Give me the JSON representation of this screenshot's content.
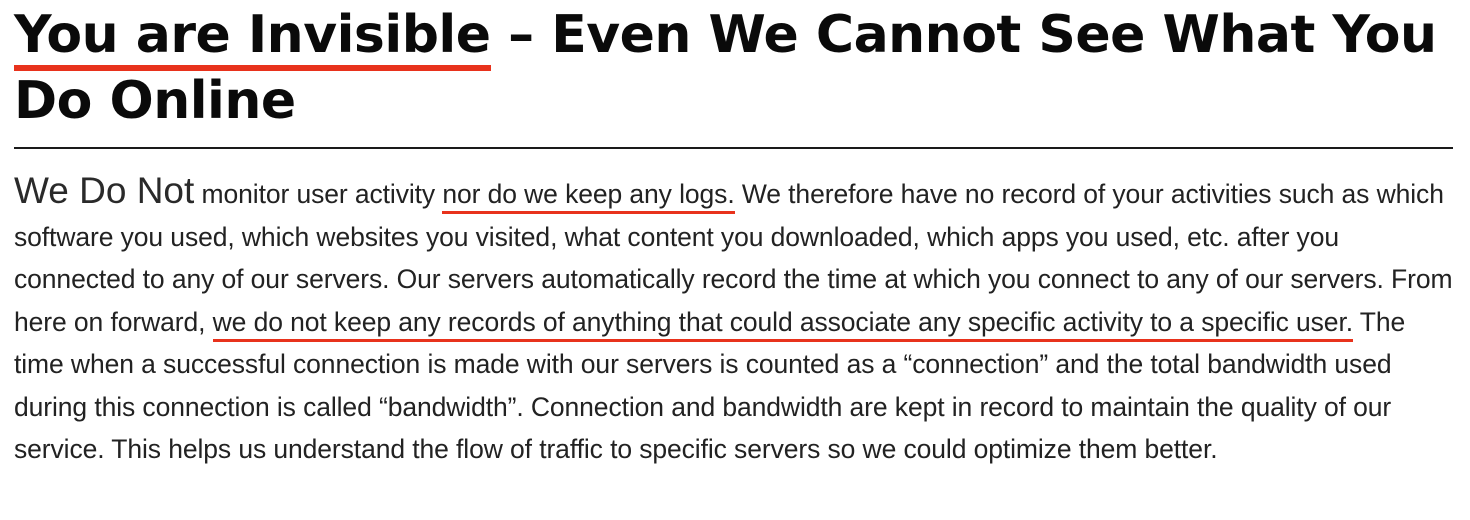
{
  "article": {
    "title_highlighted": "You are Invisible",
    "title_rest": " – Even We Cannot See What You Do Online",
    "lead": "We Do Not",
    "p1": " monitor user activity ",
    "p1_highlight": "nor do we keep any logs.",
    "p2": " We therefore have no record of your activities such as which software you used, which websites you visited, what content you downloaded, which apps you used, etc. after you connected to any of our servers. Our servers automatically record the time at which you connect to any of our servers. From here on forward, ",
    "p2_highlight": "we do not keep any records of anything that could associate any specific activity to a specific user.",
    "p3": " The time when a successful connection is made with our servers is counted as a “connection” and the total bandwidth used during this connection is called “bandwidth”. Connection and bandwidth are kept in record to maintain the quality of our service. This helps us understand the flow of traffic to specific servers so we could optimize them better."
  },
  "colors": {
    "highlight_underline": "#e8321c",
    "text": "#222222",
    "heading": "#0a0a0a"
  }
}
